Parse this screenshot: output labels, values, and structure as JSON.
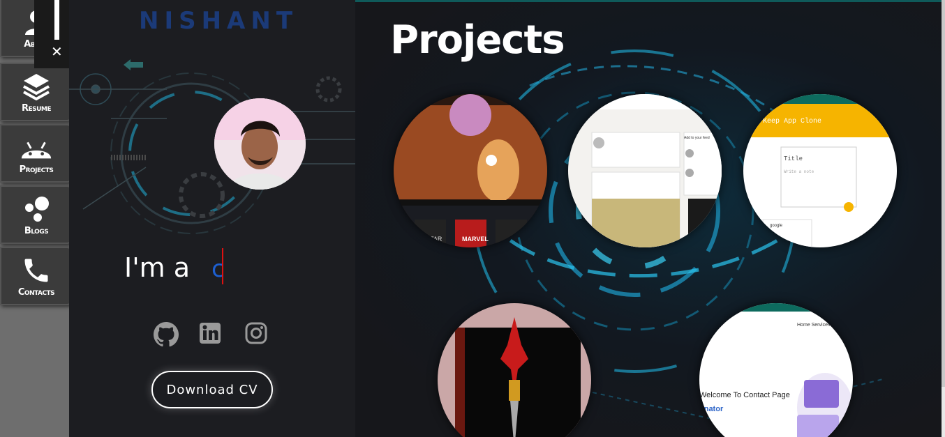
{
  "nav": {
    "items": [
      {
        "label": "About",
        "icon": "person-icon"
      },
      {
        "label": "Resume",
        "icon": "layers-icon"
      },
      {
        "label": "Projects",
        "icon": "android-icon"
      },
      {
        "label": "Blogs",
        "icon": "bubbles-icon"
      },
      {
        "label": "Contacts",
        "icon": "phone-icon"
      }
    ],
    "close_label": "✕"
  },
  "profile": {
    "logo": "NISHANT",
    "intro": "I'm a",
    "typed_text": "c",
    "cv_button": "Download CV",
    "social": [
      "github-icon",
      "linkedin-icon",
      "instagram-icon"
    ]
  },
  "projects": {
    "title": "Projects",
    "cards": [
      {
        "name": "cartoon-streaming-project",
        "caption": "MARVEL",
        "caption2": "STAR"
      },
      {
        "name": "linkedin-clone-project",
        "caption": "Add to your feed"
      },
      {
        "name": "keep-app-clone-project",
        "caption": "Keep App Clone",
        "field1": "Title",
        "field2": "Write a note",
        "note": "google"
      },
      {
        "name": "sword-game-project",
        "caption": ""
      },
      {
        "name": "contact-page-project",
        "caption": "Welcome To Contact Page",
        "subcaption": "onator",
        "nav": "Home  Services  Ab"
      }
    ]
  },
  "colors": {
    "accent_blue": "#1b3a78",
    "keep_yellow": "#f6b400",
    "cursor_red": "#dd1111"
  }
}
